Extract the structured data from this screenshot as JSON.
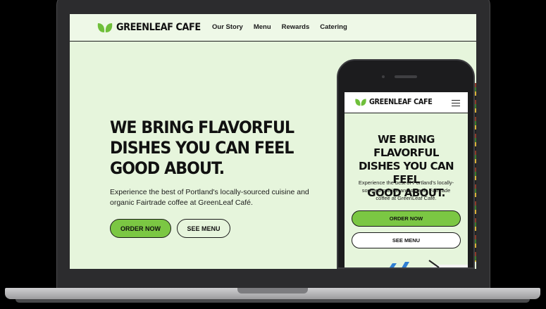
{
  "colors": {
    "background": "#e6f5dc",
    "accent": "#7bc743",
    "text": "#111111"
  },
  "brand": {
    "name": "GREENLEAF CAFE",
    "logo_icon": "leaf-icon"
  },
  "nav": {
    "links": [
      "Our Story",
      "Menu",
      "Rewards",
      "Catering"
    ]
  },
  "hero": {
    "title": "WE BRING FLAVORFUL\nDISHES YOU CAN FEEL\nGOOD ABOUT.",
    "subtitle": "Experience the best of Portland's locally-sourced cuisine and\norganic Fairtrade coffee at GreenLeaf Café.",
    "order_button": "ORDER NOW",
    "menu_button": "SEE MENU"
  },
  "mobile": {
    "brand": "GREENLEAF CAFE",
    "menu_icon": "hamburger-icon",
    "title": "WE BRING FLAVORFUL\nDISHES YOU CAN FEEL\nGOOD ABOUT.",
    "subtitle": "Experience the best of Portland's locally-\nsourced cuisine and organic Fairtrade\ncoffee at GreenLeaf Café.",
    "order_button": "ORDER NOW",
    "menu_button": "SEE MENU"
  }
}
